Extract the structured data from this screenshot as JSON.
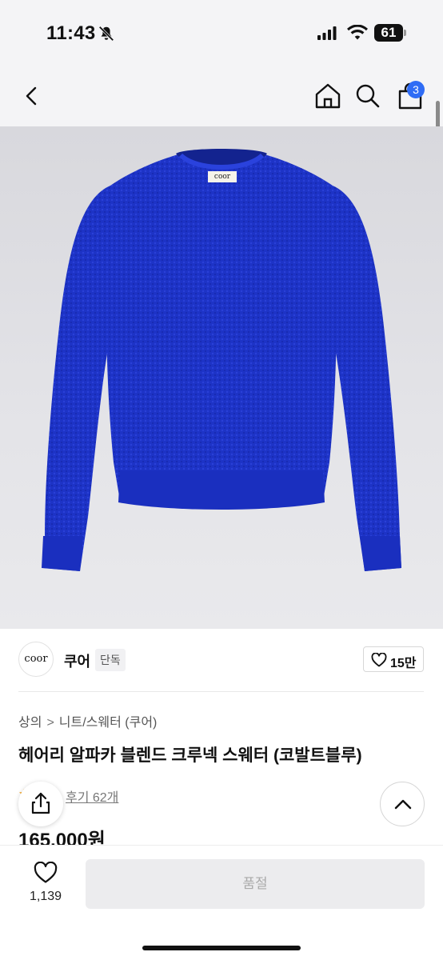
{
  "status_bar": {
    "time": "11:43",
    "battery": "61",
    "icons": [
      "bell-muted-icon",
      "signal-icon",
      "wifi-icon",
      "battery-icon"
    ]
  },
  "nav": {
    "icons": [
      "back-icon",
      "home-icon",
      "search-icon",
      "shopping-bag-icon"
    ],
    "cart_count": "3"
  },
  "product_image": {
    "logo_label": "coor",
    "sweater_color": "#1f34c9"
  },
  "brand": {
    "logo_text": "coor",
    "name": "쿠어",
    "tag": "단독",
    "likes": "15만"
  },
  "breadcrumb": {
    "category": "상의",
    "separator": ">",
    "subcategory": "니트/스웨터 (쿠어)"
  },
  "product": {
    "title": "헤어리 알파카 블렌드 크루넥 스웨터 (코발트블루)",
    "reviews": "후기 62개",
    "price": "165,000원"
  },
  "bottom_bar": {
    "wishlist_count": "1,139",
    "soldout_label": "품절"
  },
  "colors": {
    "accent": "#2f6cf5",
    "text": "#111111",
    "muted": "#777777"
  }
}
